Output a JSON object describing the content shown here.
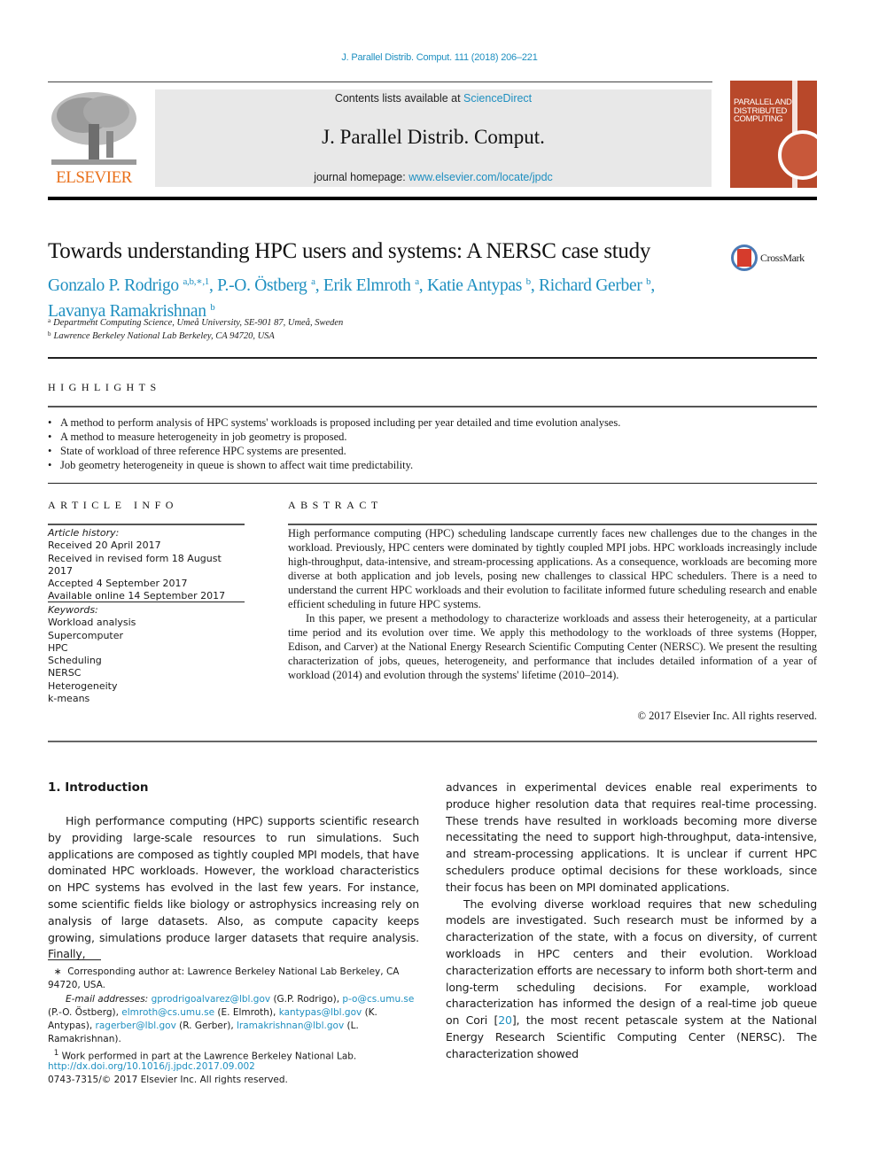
{
  "header": {
    "citation": "J. Parallel Distrib. Comput. 111 (2018) 206–221",
    "publisher_logo_text": "ELSEVIER",
    "contents_prefix": "Contents lists available at ",
    "contents_link": "ScienceDirect",
    "journal_name": "J. Parallel Distrib. Comput.",
    "homepage_prefix": "journal homepage: ",
    "homepage_link": "www.elsevier.com/locate/jpdc",
    "cover_title_lines": [
      "PARALLEL AND",
      "DISTRIBUTED",
      "COMPUTING"
    ],
    "crossmark_label": "CrossMark"
  },
  "article": {
    "title": "Towards understanding HPC users and systems: A NERSC case study",
    "authors": [
      {
        "name": "Gonzalo P. Rodrigo",
        "sup": "a,b,∗,1"
      },
      {
        "name": "P.-O. Östberg",
        "sup": "a"
      },
      {
        "name": "Erik Elmroth",
        "sup": "a"
      },
      {
        "name": "Katie Antypas",
        "sup": "b"
      },
      {
        "name": "Richard Gerber",
        "sup": "b"
      },
      {
        "name": "Lavanya Ramakrishnan",
        "sup": "b"
      }
    ],
    "affiliations": [
      {
        "mark": "a",
        "text": "Department Computing Science, Umeå University, SE-901 87, Umeå, Sweden"
      },
      {
        "mark": "b",
        "text": "Lawrence Berkeley National Lab Berkeley, CA 94720, USA"
      }
    ]
  },
  "highlights": {
    "label": "HIGHLIGHTS",
    "items": [
      "A method to perform analysis of HPC systems' workloads is proposed including per year detailed and time evolution analyses.",
      "A method to measure heterogeneity in job geometry is proposed.",
      "State of workload of three reference HPC systems are presented.",
      "Job geometry heterogeneity in queue is shown to affect wait time predictability."
    ]
  },
  "article_info": {
    "label": "ARTICLE INFO",
    "history_label": "Article history:",
    "history": [
      "Received 20 April 2017",
      "Received in revised form 18 August 2017",
      "Accepted 4 September 2017",
      "Available online 14 September 2017"
    ],
    "keywords_label": "Keywords:",
    "keywords": [
      "Workload analysis",
      "Supercomputer",
      "HPC",
      "Scheduling",
      "NERSC",
      "Heterogeneity",
      "k-means"
    ]
  },
  "abstract": {
    "label": "ABSTRACT",
    "paragraphs": [
      "High performance computing (HPC) scheduling landscape currently faces new challenges due to the changes in the workload. Previously, HPC centers were dominated by tightly coupled MPI jobs. HPC workloads increasingly include high-throughput, data-intensive, and stream-processing applications. As a consequence, workloads are becoming more diverse at both application and job levels, posing new challenges to classical HPC schedulers. There is a need to understand the current HPC workloads and their evolution to facilitate informed future scheduling research and enable efficient scheduling in future HPC systems.",
      "In this paper, we present a methodology to characterize workloads and assess their heterogeneity, at a particular time period and its evolution over time. We apply this methodology to the workloads of three systems (Hopper, Edison, and Carver) at the National Energy Research Scientific Computing Center (NERSC). We present the resulting characterization of jobs, queues, heterogeneity, and performance that includes detailed information of a year of workload (2014) and evolution through the systems' lifetime (2010–2014)."
    ],
    "copyright": "© 2017 Elsevier Inc. All rights reserved."
  },
  "introduction": {
    "heading": "1.  Introduction",
    "left_paragraph": "High performance computing (HPC) supports scientific research by providing large-scale resources to run simulations. Such applications are composed as tightly coupled MPI models, that have dominated HPC workloads. However, the workload characteristics on HPC systems has evolved in the last few years. For instance, some scientific fields like biology or astrophysics increasing rely on analysis of large datasets. Also, as compute capacity keeps growing, simulations produce larger datasets that require analysis. Finally,",
    "right_paragraph_1": "advances in experimental devices enable real experiments to produce higher resolution data that requires real-time processing. These trends have resulted in workloads becoming more diverse necessitating the need to support high-throughput, data-intensive, and stream-processing applications. It is unclear if current HPC schedulers produce optimal decisions for these workloads, since their focus has been on MPI dominated applications.",
    "right_paragraph_2_before_ref": "The evolving diverse workload requires that new scheduling models are investigated. Such research must be informed by a characterization of the state, with a focus on diversity, of current workloads in HPC centers and their evolution. Workload characterization efforts are necessary to inform both short-term and long-term scheduling decisions. For example, workload characterization has informed the design of a real-time job queue on Cori [",
    "ref": "20",
    "right_paragraph_2_after_ref": "], the most recent petascale system at the National Energy Research Scientific Computing Center (NERSC). The characterization showed"
  },
  "footnotes": {
    "corresponding_mark": "∗",
    "corresponding": "Corresponding author at: Lawrence Berkeley National Lab Berkeley, CA 94720, USA.",
    "email_label": "E-mail addresses:",
    "emails": [
      {
        "email": "gprodrigoalvarez@lbl.gov",
        "who": "(G.P. Rodrigo)"
      },
      {
        "email": "p-o@cs.umu.se",
        "who": "(P.-O. Östberg)"
      },
      {
        "email": "elmroth@cs.umu.se",
        "who": "(E. Elmroth)"
      },
      {
        "email": "kantypas@lbl.gov",
        "who": "(K. Antypas)"
      },
      {
        "email": "ragerber@lbl.gov",
        "who": "(R. Gerber)"
      },
      {
        "email": "lramakrishnan@lbl.gov",
        "who": "(L. Ramakrishnan)."
      }
    ],
    "note1_mark": "1",
    "note1": "Work performed in part at the Lawrence Berkeley National Lab.",
    "doi": "http://dx.doi.org/10.1016/j.jpdc.2017.09.002",
    "issn": "0743-7315/© 2017 Elsevier Inc. All rights reserved."
  }
}
